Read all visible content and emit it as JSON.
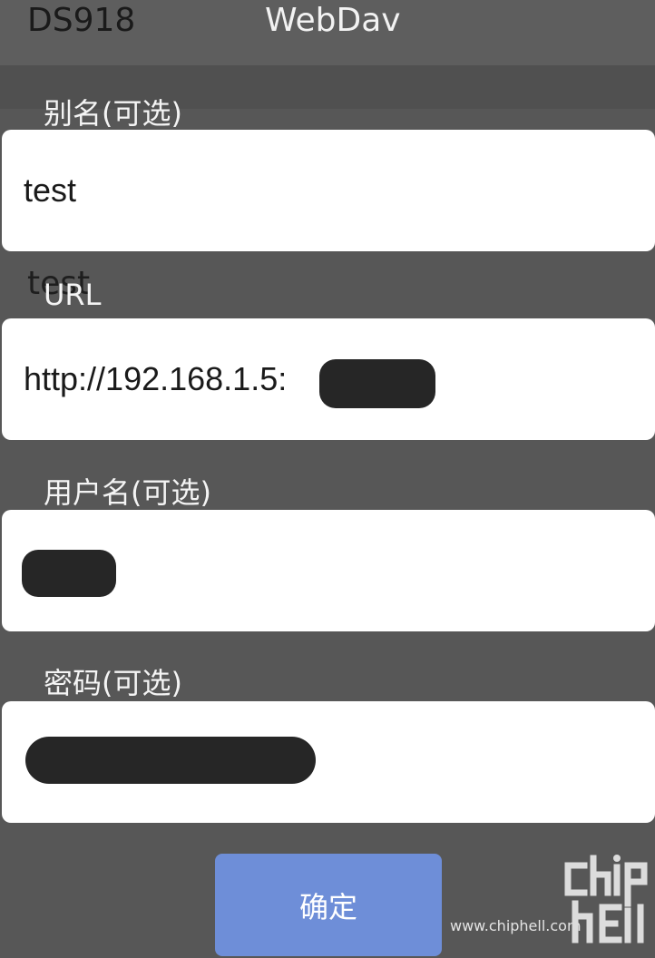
{
  "background": {
    "title": "DS918",
    "subtitle": "WebDav",
    "ghost_text": "test"
  },
  "dialog": {
    "fields": [
      {
        "label": "别名(可选)",
        "value": "test"
      },
      {
        "label": "URL",
        "value": "http://192.168.1.5:"
      },
      {
        "label": "用户名(可选)",
        "value": ""
      },
      {
        "label": "密码(可选)",
        "value": ""
      }
    ],
    "confirm_label": "确定"
  },
  "watermark": {
    "site": "www.chiphell.com",
    "logo": "chiphell-logo"
  },
  "colors": {
    "overlay_bg": "#575757",
    "field_bg": "#ffffff",
    "button_bg": "#6e8ed8",
    "redaction": "#262626"
  }
}
